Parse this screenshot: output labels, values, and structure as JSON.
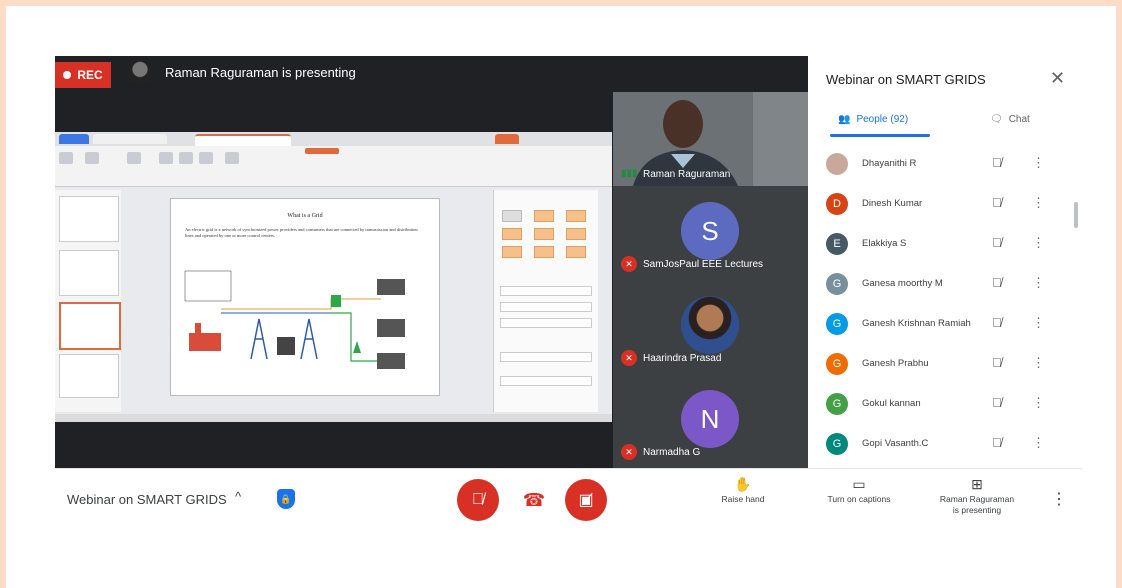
{
  "stage": {
    "rec_label": "REC",
    "presenting_text": "Raman Raguraman is presenting"
  },
  "slide": {
    "title": "What is a Grid",
    "bullet": "An electric grid is a network of synchronized power providers and consumers that are connected by transmission and distribution lines and operated by one or more control centers."
  },
  "tiles": [
    {
      "name": "Raman Raguraman",
      "type": "video"
    },
    {
      "name": "SamJosPaul EEE Lectures",
      "initial": "S",
      "color": "#5c6bc0"
    },
    {
      "name": "Haarindra Prasad",
      "type": "photo"
    },
    {
      "name": "Narmadha G",
      "initial": "N",
      "color": "#7b57c7"
    }
  ],
  "side_panel": {
    "title": "Webinar on SMART GRIDS",
    "tab_people": "People (92)",
    "tab_chat": "Chat",
    "participants": [
      {
        "name": "Dhayanithi R",
        "initial": "",
        "color": "#c8a89a"
      },
      {
        "name": "Dinesh Kumar",
        "initial": "D",
        "color": "#d84315"
      },
      {
        "name": "Elakkiya S",
        "initial": "E",
        "color": "#455a64"
      },
      {
        "name": "Ganesa moorthy M",
        "initial": "G",
        "color": "#78909c"
      },
      {
        "name": "Ganesh Krishnan Ramiah",
        "initial": "G",
        "color": "#039be5"
      },
      {
        "name": "Ganesh Prabhu",
        "initial": "G",
        "color": "#ef6c00"
      },
      {
        "name": "Gokul kannan",
        "initial": "G",
        "color": "#43a047"
      },
      {
        "name": "Gopi Vasanth.C",
        "initial": "G",
        "color": "#00897b"
      }
    ]
  },
  "bottombar": {
    "meeting_title": "Webinar on SMART GRIDS",
    "raise_hand": "Raise hand",
    "captions": "Turn on captions",
    "presenting_line1": "Raman Raguraman",
    "presenting_line2": "is presenting"
  },
  "colors": {
    "accent": "#1a73e8",
    "danger": "#d93025",
    "stage": "#202124"
  }
}
